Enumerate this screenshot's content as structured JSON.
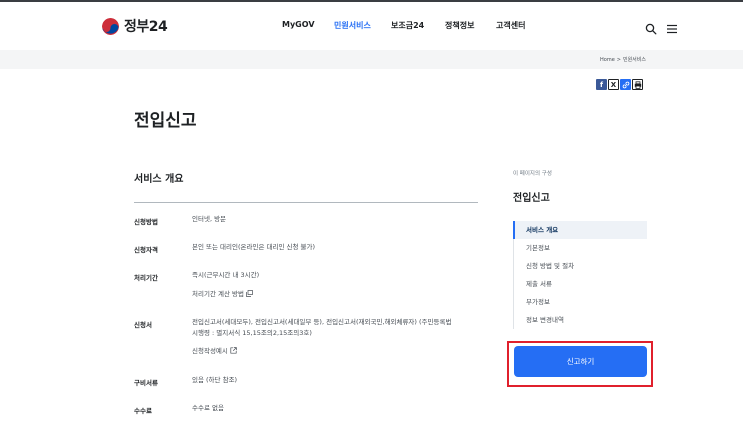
{
  "header": {
    "logo_text": "정부24",
    "nav": [
      {
        "label": "MyGOV",
        "active": false
      },
      {
        "label": "민원서비스",
        "active": true
      },
      {
        "label": "보조금24",
        "active": false
      },
      {
        "label": "정책정보",
        "active": false
      },
      {
        "label": "고객센터",
        "active": false
      }
    ],
    "icons": [
      "search-icon",
      "menu-icon"
    ]
  },
  "breadcrumb": {
    "home": "Home",
    "separator": ">",
    "current": "민원서비스"
  },
  "share": [
    {
      "name": "facebook-icon",
      "glyph": "f",
      "color": "#3b5998"
    },
    {
      "name": "x-icon",
      "glyph": "𝕏",
      "color": "#ffffff"
    },
    {
      "name": "link-icon",
      "glyph": "🔗",
      "color": "#256ef4"
    },
    {
      "name": "print-icon",
      "glyph": "⎙",
      "color": "#ffffff"
    }
  ],
  "page_title": "전입신고",
  "section": {
    "title": "서비스 개요",
    "rows": [
      {
        "label": "신청방법",
        "lines": [
          "인터넷, 방문"
        ]
      },
      {
        "label": "신청자격",
        "lines": [
          "본인 또는 대리인(온라인은 대리인 신청 불가)"
        ]
      },
      {
        "label": "처리기간",
        "lines": [
          "즉시(근무시간 내 3시간)"
        ],
        "link": "처리기간 계산 방법"
      },
      {
        "label": "신청서",
        "lines": [
          "전입신고서(세대모두), 전입신고서(세대일부 등), 전입신고서(재외국민,해외체류자) (주민등록법",
          "시행령 : 별지서식 15,15조의2,15조의3호)"
        ],
        "link": "신청작성예시"
      },
      {
        "label": "구비서류",
        "lines": [
          "있음 (하단 참조)"
        ]
      },
      {
        "label": "수수료",
        "lines": [
          "수수료 없음"
        ]
      }
    ]
  },
  "side": {
    "caption": "이 페이지의 구성",
    "title": "전입신고",
    "items": [
      {
        "label": "서비스 개요",
        "active": true
      },
      {
        "label": "기본정보",
        "active": false
      },
      {
        "label": "신청 방법 및 절차",
        "active": false
      },
      {
        "label": "제출 서류",
        "active": false
      },
      {
        "label": "부가정보",
        "active": false
      },
      {
        "label": "정보 변경내역",
        "active": false
      }
    ],
    "cta_label": "신고하기"
  },
  "colors": {
    "brand_blue": "#256ef4",
    "highlight_red": "#e0202c",
    "logo_red": "#cd2e3a",
    "logo_blue": "#0047a0"
  }
}
